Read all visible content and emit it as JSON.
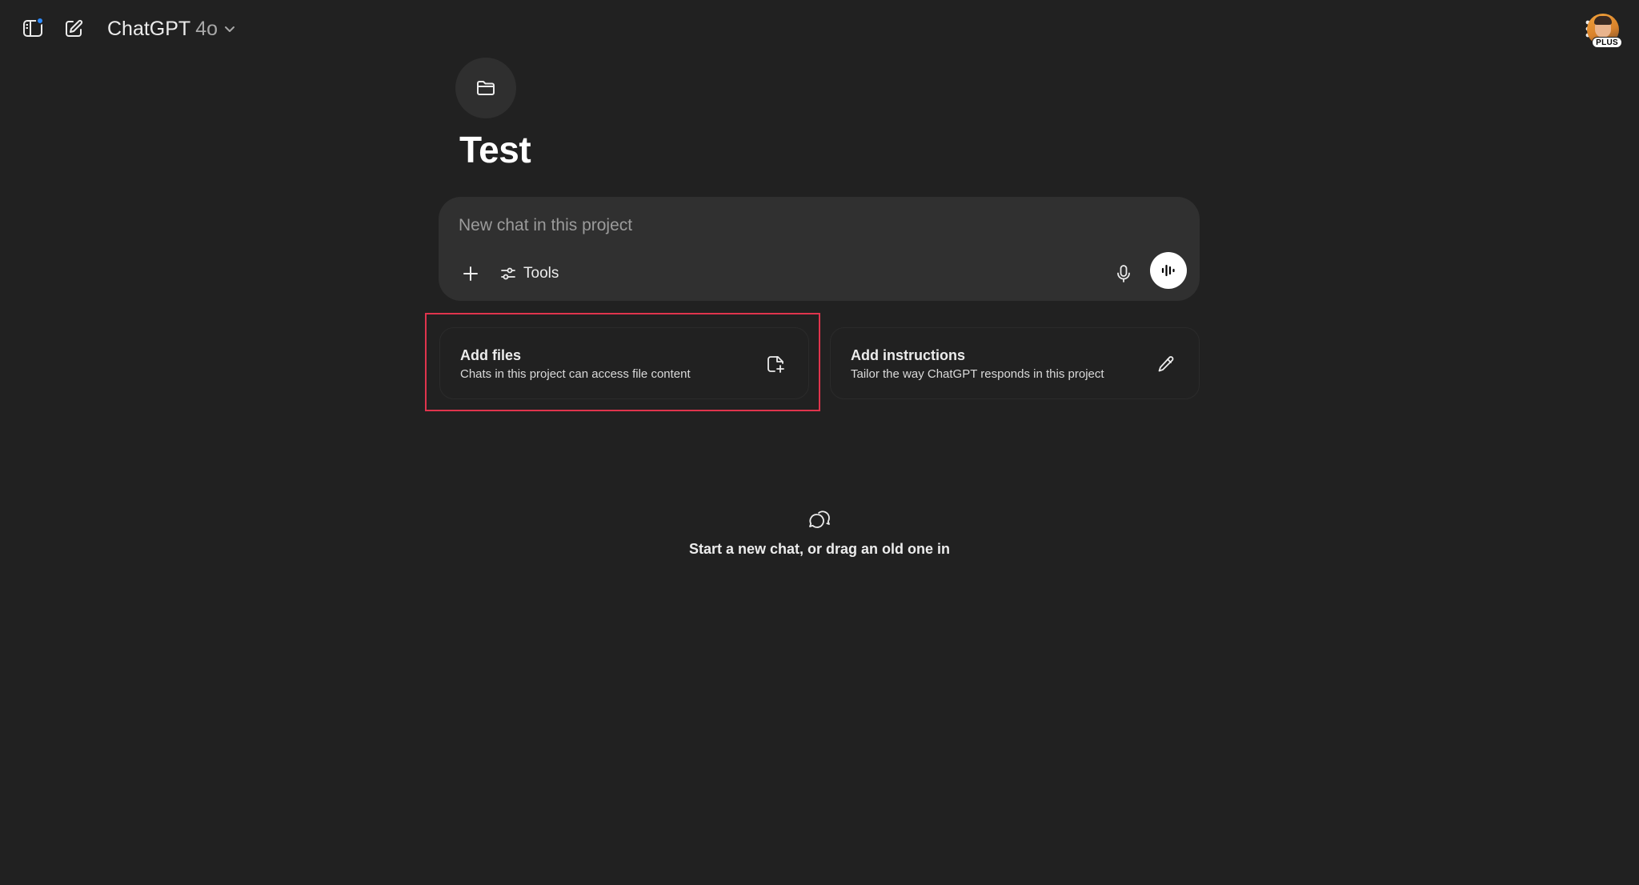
{
  "header": {
    "model_name": "ChatGPT",
    "model_version": "4o",
    "icons": {
      "sidebar": "sidebar-toggle-icon",
      "new_chat": "compose-icon",
      "model_dropdown": "chevron-down-icon",
      "more": "more-vertical-icon"
    },
    "plan_badge": "PLUS",
    "notification_color": "#2e8bff"
  },
  "project": {
    "icon": "folder-icon",
    "title": "Test"
  },
  "composer": {
    "placeholder": "New chat in this project",
    "tools_label": "Tools",
    "icons": {
      "add": "plus-icon",
      "tools": "sliders-icon",
      "mic": "microphone-icon",
      "voice": "voice-waveform-icon"
    }
  },
  "cards": [
    {
      "title": "Add files",
      "subtitle": "Chats in this project can access file content",
      "icon": "add-file-icon"
    },
    {
      "title": "Add instructions",
      "subtitle": "Tailor the way ChatGPT responds in this project",
      "icon": "pencil-icon"
    }
  ],
  "empty_state": {
    "icon": "chat-bubbles-icon",
    "message": "Start a new chat, or drag an old one in"
  },
  "colors": {
    "background": "#212121",
    "composer": "#303030",
    "highlight": "#e0344d"
  }
}
